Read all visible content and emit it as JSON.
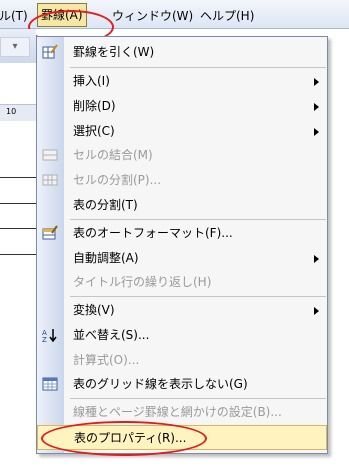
{
  "menubar": {
    "items": [
      {
        "label": "ル(T)"
      },
      {
        "label": "罫線(A)"
      },
      {
        "label": "ウィンドウ(W)"
      },
      {
        "label": "ヘルプ(H)"
      }
    ]
  },
  "ruler": {
    "mark": "10"
  },
  "menu": {
    "items": [
      {
        "label": "罫線を引く(W)",
        "icon": "draw-table-icon"
      },
      {
        "label": "挿入(I)",
        "submenu": true
      },
      {
        "label": "削除(D)",
        "submenu": true
      },
      {
        "label": "選択(C)",
        "submenu": true
      },
      {
        "label": "セルの結合(M)",
        "disabled": true,
        "icon": "merge-cells-icon"
      },
      {
        "label": "セルの分割(P)...",
        "disabled": true,
        "icon": "split-cells-icon"
      },
      {
        "label": "表の分割(T)"
      },
      {
        "label": "表のオートフォーマット(F)...",
        "icon": "autoformat-icon"
      },
      {
        "label": "自動調整(A)",
        "submenu": true
      },
      {
        "label": "タイトル行の繰り返し(H)",
        "disabled": true
      },
      {
        "label": "変換(V)",
        "submenu": true
      },
      {
        "label": "並べ替え(S)...",
        "icon": "sort-icon"
      },
      {
        "label": "計算式(O)...",
        "disabled": true
      },
      {
        "label": "表のグリッド線を表示しない(G)",
        "icon": "gridlines-icon"
      },
      {
        "label": "線種とページ罫線と網かけの設定(B)...",
        "disabled": true
      },
      {
        "label": "表のプロパティ(R)...",
        "highlighted": true
      }
    ]
  },
  "colors": {
    "highlight": "#fff3c0",
    "annotation": "#e21b1b",
    "disabled": "#9a9a9a"
  }
}
